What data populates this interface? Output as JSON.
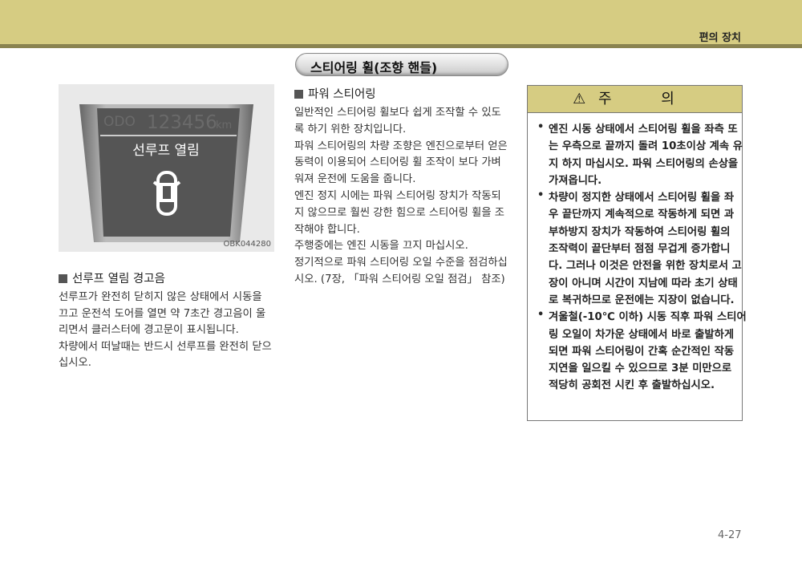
{
  "header": {
    "section": "편의 장치",
    "accent": "#d6cc82"
  },
  "figure": {
    "odo_label": "ODO",
    "odo_value": "123456",
    "odo_unit": "km",
    "message": "선루프 열림",
    "code": "OBK044280"
  },
  "left": {
    "heading": "선루프 열림 경고음",
    "lines": [
      "선루프가 완전히 닫히지 않은 상태에서 시동을",
      "끄고 운전석 도어를 열면 약 7초간 경고음이 울",
      "리면서 클러스터에 경고문이 표시됩니다.",
      "차량에서 떠날때는 반드시 선루프를 완전히 닫으",
      "십시오."
    ]
  },
  "middle": {
    "title": "스티어링 휠(조향 핸들)",
    "heading": "파워 스티어링",
    "lines": [
      "일반적인 스티어링 휠보다 쉽게 조작할 수 있도",
      "록 하기 위한 장치입니다.",
      "파워 스티어링의 차량 조향은 엔진으로부터 얻은",
      "동력이 이용되어 스티어링 휠 조작이 보다 가벼",
      "워져 운전에 도움을 줍니다.",
      "엔진 정지 시에는 파워 스티어링 장치가 작동되",
      "지 않으므로 훨씬 강한 힘으로 스티어링 휠을 조",
      "작해야 합니다.",
      "주행중에는 엔진 시동을 끄지 마십시오.",
      "정기적으로 파워 스티어링 오일 수준을 점검하십",
      "시오. (7장, 「파워 스티어링 오일 점검」 참조)"
    ]
  },
  "caution": {
    "title": "주의",
    "items": [
      {
        "lines": [
          "엔진 시동 상태에서 스티어링 휠을 좌측 또",
          "는 우측으로 끝까지 돌려 10초이상 계속 유",
          "지 하지 마십시오. 파워 스티어링의 손상을",
          "가져옵니다."
        ]
      },
      {
        "lines": [
          "차량이 정지한 상태에서 스티어링 휠을 좌",
          "우 끝단까지 계속적으로 작동하게 되면 과",
          "부하방지 장치가 작동하여 스티어링 휠의",
          "조작력이 끝단부터 점점 무겁게 증가합니",
          "다. 그러나 이것은 안전을 위한 장치로서 고",
          "장이 아니며 시간이 지남에 따라 초기 상태",
          "로 복귀하므로 운전에는 지장이 없습니다."
        ]
      },
      {
        "lines": [
          "겨울철(-10℃ 이하) 시동 직후 파워 스티어",
          "링 오일이 차가운 상태에서 바로 출발하게",
          "되면 파워 스티어링이 간혹 순간적인 작동",
          "지연을 일으킬 수 있으므로 3분 미만으로",
          "적당히 공회전 시킨 후 출발하십시오."
        ]
      }
    ]
  },
  "page_number": "4-27"
}
